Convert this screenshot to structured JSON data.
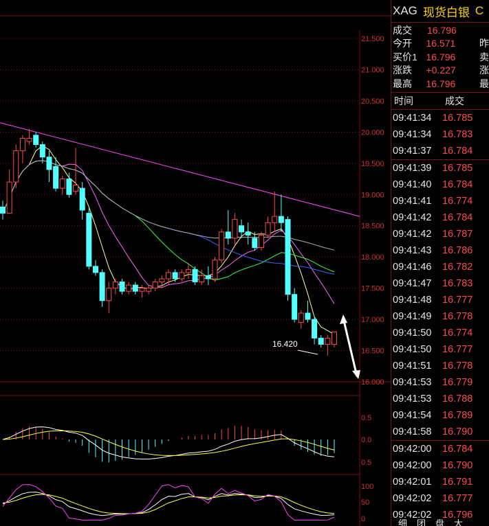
{
  "header": {
    "code": "XAG",
    "name": "现货白银",
    "extra": "C"
  },
  "quote": [
    {
      "label": "成交",
      "value": "16.796",
      "label2": ""
    },
    {
      "label": "今开",
      "value": "16.571",
      "label2": "昨"
    },
    {
      "label": "买价1",
      "value": "16.796",
      "label2": "卖"
    },
    {
      "label": "涨跌",
      "value": "+0.227",
      "label2": "涨"
    },
    {
      "label": "最高",
      "value": "16.796",
      "label2": "最"
    }
  ],
  "ticks_header": {
    "time": "时间",
    "price": "成交"
  },
  "ticks": [
    {
      "time": "09:41:34",
      "price": "16.785"
    },
    {
      "time": "09:41:34",
      "price": "16.783"
    },
    {
      "time": "09:41:37",
      "price": "16.784"
    },
    {
      "time": "09:41:39",
      "price": "16.785"
    },
    {
      "time": "09:41:40",
      "price": "16.784"
    },
    {
      "time": "09:41:41",
      "price": "16.774"
    },
    {
      "time": "09:41:42",
      "price": "16.784"
    },
    {
      "time": "09:41:42",
      "price": "16.787"
    },
    {
      "time": "09:41:43",
      "price": "16.786"
    },
    {
      "time": "09:41:46",
      "price": "16.782"
    },
    {
      "time": "09:41:47",
      "price": "16.783"
    },
    {
      "time": "09:41:48",
      "price": "16.777"
    },
    {
      "time": "09:41:49",
      "price": "16.778"
    },
    {
      "time": "09:41:50",
      "price": "16.774"
    },
    {
      "time": "09:41:50",
      "price": "16.777"
    },
    {
      "time": "09:41:51",
      "price": "16.778"
    },
    {
      "time": "09:41:53",
      "price": "16.779"
    },
    {
      "time": "09:41:53",
      "price": "16.788"
    },
    {
      "time": "09:41:54",
      "price": "16.789"
    },
    {
      "time": "09:41:58",
      "price": "16.790"
    },
    {
      "time": "09:42:00",
      "price": "16.784"
    },
    {
      "time": "09:42:00",
      "price": "16.790"
    },
    {
      "time": "09:42:01",
      "price": "16.791"
    },
    {
      "time": "09:42:02",
      "price": "16.777"
    },
    {
      "time": "09:42:02",
      "price": "16.796"
    }
  ],
  "bottom_tabs": [
    "细",
    "团",
    "盘",
    "大"
  ],
  "colors": {
    "up": "#ff4a4a",
    "down": "#54ffff",
    "grid": "#7a1010",
    "axis_text": "#d03030"
  },
  "chart_data": {
    "type": "candlestick",
    "price_axis": {
      "min": 16.0,
      "max": 21.5,
      "ticks": [
        "21.500",
        "21.000",
        "20.500",
        "20.000",
        "19.500",
        "19.000",
        "18.500",
        "18.000",
        "17.500",
        "17.000",
        "16.500",
        "16.000"
      ]
    },
    "low_annotation": "16.420",
    "candles": [
      {
        "o": 18.8,
        "h": 18.9,
        "l": 18.6,
        "c": 18.7
      },
      {
        "o": 18.7,
        "h": 19.4,
        "l": 18.7,
        "c": 19.2
      },
      {
        "o": 19.2,
        "h": 19.8,
        "l": 19.1,
        "c": 19.7
      },
      {
        "o": 19.7,
        "h": 19.95,
        "l": 19.5,
        "c": 19.9
      },
      {
        "o": 19.85,
        "h": 20.05,
        "l": 19.8,
        "c": 19.9
      },
      {
        "o": 19.95,
        "h": 20.0,
        "l": 19.75,
        "c": 19.8
      },
      {
        "o": 19.8,
        "h": 19.85,
        "l": 19.5,
        "c": 19.6
      },
      {
        "o": 19.6,
        "h": 19.7,
        "l": 19.2,
        "c": 19.4
      },
      {
        "o": 19.45,
        "h": 19.6,
        "l": 19.05,
        "c": 19.1
      },
      {
        "o": 19.1,
        "h": 19.3,
        "l": 19.0,
        "c": 19.25
      },
      {
        "o": 19.25,
        "h": 19.35,
        "l": 18.95,
        "c": 19.0
      },
      {
        "o": 19.05,
        "h": 19.75,
        "l": 19.0,
        "c": 19.15
      },
      {
        "o": 19.1,
        "h": 19.2,
        "l": 18.6,
        "c": 18.75
      },
      {
        "o": 18.7,
        "h": 18.8,
        "l": 17.8,
        "c": 17.85
      },
      {
        "o": 17.85,
        "h": 17.95,
        "l": 17.7,
        "c": 17.75
      },
      {
        "o": 17.75,
        "h": 17.8,
        "l": 17.2,
        "c": 17.3
      },
      {
        "o": 17.3,
        "h": 17.6,
        "l": 17.1,
        "c": 17.5
      },
      {
        "o": 17.5,
        "h": 17.65,
        "l": 17.4,
        "c": 17.6
      },
      {
        "o": 17.6,
        "h": 17.65,
        "l": 17.4,
        "c": 17.45
      },
      {
        "o": 17.45,
        "h": 17.6,
        "l": 17.4,
        "c": 17.55
      },
      {
        "o": 17.55,
        "h": 17.6,
        "l": 17.4,
        "c": 17.45
      },
      {
        "o": 17.45,
        "h": 17.55,
        "l": 17.35,
        "c": 17.5
      },
      {
        "o": 17.45,
        "h": 17.55,
        "l": 17.4,
        "c": 17.5
      },
      {
        "o": 17.5,
        "h": 17.65,
        "l": 17.45,
        "c": 17.6
      },
      {
        "o": 17.6,
        "h": 17.7,
        "l": 17.5,
        "c": 17.65
      },
      {
        "o": 17.65,
        "h": 17.8,
        "l": 17.55,
        "c": 17.75
      },
      {
        "o": 17.75,
        "h": 17.8,
        "l": 17.6,
        "c": 17.65
      },
      {
        "o": 17.65,
        "h": 17.8,
        "l": 17.6,
        "c": 17.75
      },
      {
        "o": 17.75,
        "h": 17.9,
        "l": 17.65,
        "c": 17.8
      },
      {
        "o": 17.8,
        "h": 17.85,
        "l": 17.55,
        "c": 17.6
      },
      {
        "o": 17.6,
        "h": 17.8,
        "l": 17.55,
        "c": 17.7
      },
      {
        "o": 17.7,
        "h": 17.85,
        "l": 17.55,
        "c": 17.65
      },
      {
        "o": 17.65,
        "h": 18.0,
        "l": 17.6,
        "c": 17.95
      },
      {
        "o": 17.95,
        "h": 18.45,
        "l": 17.9,
        "c": 18.4
      },
      {
        "o": 18.4,
        "h": 18.75,
        "l": 18.2,
        "c": 18.3
      },
      {
        "o": 18.3,
        "h": 18.7,
        "l": 18.2,
        "c": 18.6
      },
      {
        "o": 18.5,
        "h": 18.6,
        "l": 18.3,
        "c": 18.4
      },
      {
        "o": 18.4,
        "h": 18.55,
        "l": 18.2,
        "c": 18.35
      },
      {
        "o": 18.3,
        "h": 18.4,
        "l": 18.1,
        "c": 18.15
      },
      {
        "o": 18.15,
        "h": 18.4,
        "l": 18.1,
        "c": 18.35
      },
      {
        "o": 18.35,
        "h": 18.65,
        "l": 18.3,
        "c": 18.55
      },
      {
        "o": 18.55,
        "h": 19.05,
        "l": 18.4,
        "c": 18.65
      },
      {
        "o": 18.65,
        "h": 19.0,
        "l": 18.4,
        "c": 18.55
      },
      {
        "o": 18.6,
        "h": 18.65,
        "l": 17.3,
        "c": 17.4
      },
      {
        "o": 17.4,
        "h": 17.5,
        "l": 16.95,
        "c": 17.0
      },
      {
        "o": 16.95,
        "h": 17.15,
        "l": 16.85,
        "c": 17.1
      },
      {
        "o": 17.1,
        "h": 17.3,
        "l": 16.95,
        "c": 17.0
      },
      {
        "o": 17.0,
        "h": 17.05,
        "l": 16.6,
        "c": 16.7
      },
      {
        "o": 16.7,
        "h": 16.75,
        "l": 16.55,
        "c": 16.6
      },
      {
        "o": 16.6,
        "h": 16.75,
        "l": 16.42,
        "c": 16.7
      },
      {
        "o": 16.6,
        "h": 16.8,
        "l": 16.55,
        "c": 16.8
      }
    ],
    "macd_axis": [
      "0.5",
      "0.0",
      "0.5"
    ],
    "kdj_axis": [
      "100",
      "50",
      "0"
    ]
  }
}
